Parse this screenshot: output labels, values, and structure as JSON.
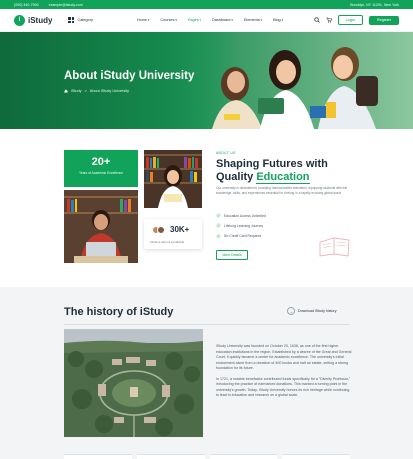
{
  "topbar": {
    "phone": "(000) 440-7990",
    "email": "example@istudy.com",
    "address": "Brooklyn, NY 11201, New York"
  },
  "nav": {
    "logo_text": "iStudy",
    "category": "Category",
    "menu": [
      "Home",
      "Courses",
      "Pages",
      "Dashboard",
      "Elements",
      "Blog"
    ],
    "active_menu": "Pages",
    "login": "Login",
    "register": "Register"
  },
  "hero": {
    "title": "About iStudy University",
    "breadcrumb_home": "iStudy",
    "breadcrumb_sep": ">",
    "breadcrumb_current": "About iStudy University"
  },
  "about": {
    "eyebrow": "ABOUT US",
    "title_prefix": "Shaping Futures with Quality ",
    "title_highlight": "Education",
    "text": "Our university is dedicated to providing transformative education, equipping students with the knowledge, skills, and experiences essential for thriving in a rapidly evolving global world.",
    "stat_green_value": "20+",
    "stat_green_label": "Years of Academic Excellence",
    "stat_card_value": "30K+",
    "stat_card_label": "Lifetime alumni worldwide",
    "features": [
      "Education Access Unlimited",
      "Lifelong Learning Journey",
      "No Credit Card Required"
    ],
    "more_button": "More Details"
  },
  "history": {
    "title": "The history of iStudy",
    "link": "Download iStudy history",
    "para1": "iStudy University was founded on October 20, 1636, as one of the first higher education institutions in the region. Established by a decree of the Great and General Court, it quickly became a center for academic excellence. The university's initial endowment came from a donation of 400 books and half an estate, setting a strong foundation for its future.",
    "para2": "In 1721, a notable benefactor contributed funds specifically for a \"Divinity Professor,\" introducing the practice of earmarked donations. This marked a turning point in the university's growth. Today, iStudy University honors its rich heritage while continuing to lead in education and research on a global scale."
  },
  "colors": {
    "accent": "#12a35a",
    "dark_text": "#1f2d3a",
    "muted_text": "#6b7a86",
    "section_bg": "#f3f4f6"
  },
  "icons": [
    "search-icon",
    "cart-icon",
    "grid-icon",
    "check-icon",
    "arrow-right-icon",
    "compass-icon",
    "book-icon"
  ]
}
